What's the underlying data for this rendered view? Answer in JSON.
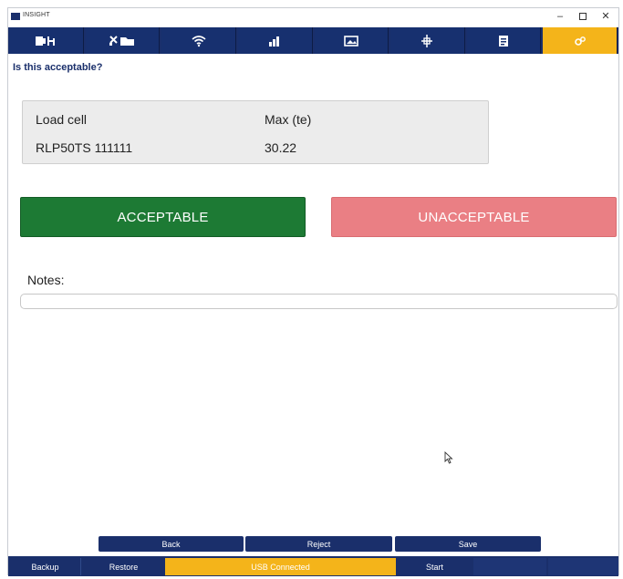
{
  "window": {
    "title": "INSIGHT",
    "controls": {
      "minimize": "–",
      "maximize": "",
      "close": "✕"
    }
  },
  "toolbar": {
    "tools": [
      {
        "icon": "loadcell-document-icon"
      },
      {
        "icon": "tools-folder-icon"
      },
      {
        "icon": "wifi-icon"
      },
      {
        "icon": "bar-chart-icon"
      },
      {
        "icon": "image-icon"
      },
      {
        "icon": "crosshair-icon"
      },
      {
        "icon": "clipboard-icon"
      },
      {
        "icon": "link-icon",
        "active": true
      }
    ],
    "active_color": "#f4b41a",
    "bar_color": "#1a2f6b"
  },
  "question": "Is this acceptable?",
  "info_card": {
    "load_cell_label": "Load cell",
    "load_cell_value": "RLP50TS 111111",
    "max_label": "Max (te)",
    "max_value": "30.22"
  },
  "decision": {
    "accept_label": "ACCEPTABLE",
    "unaccept_label": "UNACCEPTABLE",
    "accept_color": "#1d7a34",
    "unaccept_color": "#ea7f84"
  },
  "notes": {
    "label": "Notes:",
    "value": ""
  },
  "nav": {
    "back": "Back",
    "reject": "Reject",
    "save": "Save"
  },
  "status": {
    "backup": "Backup",
    "restore": "Restore",
    "usb": "USB Connected",
    "start": "Start",
    "disabled_1": "",
    "disabled_2": ""
  }
}
